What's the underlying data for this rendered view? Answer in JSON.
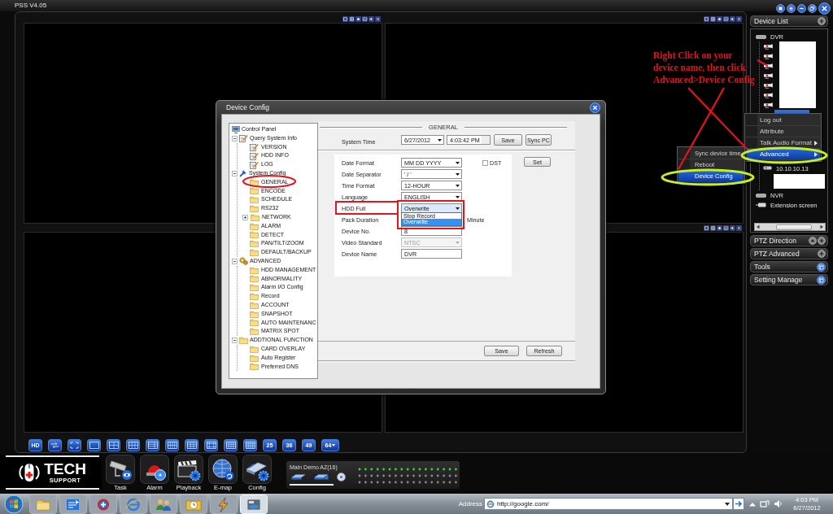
{
  "window": {
    "title": "PSS V4.05"
  },
  "video_wall": {
    "quality_button": "HD",
    "split_buttons": [
      {
        "label": "25",
        "menu": false
      },
      {
        "label": "36",
        "menu": false
      },
      {
        "label": "49",
        "menu": false
      },
      {
        "label": "64",
        "menu": true
      }
    ]
  },
  "sidebar": {
    "device_list": {
      "title": "Device List",
      "tree": [
        {
          "kind": "group",
          "label": "DVR",
          "selected": false,
          "children": [
            {
              "kind": "channel",
              "selected": false
            },
            {
              "kind": "channel",
              "selected": false
            },
            {
              "kind": "channel",
              "selected": false
            },
            {
              "kind": "channel",
              "selected": false
            },
            {
              "kind": "channel",
              "selected": false
            },
            {
              "kind": "channel",
              "selected": false
            },
            {
              "kind": "channel",
              "selected": false
            },
            {
              "kind": "device",
              "selected": true
            },
            {
              "kind": "device",
              "label": "10.10.10.13",
              "selected": false
            }
          ]
        },
        {
          "kind": "group",
          "label": "NVR",
          "selected": false
        },
        {
          "kind": "screen",
          "label": "Extension screen",
          "selected": false
        }
      ]
    },
    "sections": [
      {
        "kind": "control",
        "title": "PTZ Direction"
      },
      {
        "kind": "expand",
        "title": "PTZ Advanced"
      },
      {
        "kind": "popup",
        "title": "Tools"
      },
      {
        "kind": "popup",
        "title": "Setting Manage"
      }
    ]
  },
  "context_menu": {
    "items": [
      {
        "label": "Log out",
        "submenu": false,
        "selected": false
      },
      {
        "label": "Attribute",
        "submenu": false,
        "selected": false
      },
      {
        "label": "Talk Audio Format",
        "submenu": true,
        "selected": false
      },
      {
        "label": "Advanced",
        "submenu": true,
        "selected": true
      }
    ],
    "submenu": {
      "items": [
        {
          "label": "Sync device time",
          "selected": false
        },
        {
          "label": "Reboot",
          "selected": false
        },
        {
          "label": "Device Config",
          "selected": true
        }
      ]
    }
  },
  "annotation": {
    "text": "Right Click on your\ndevice name, then click\nAdvanced>Device Config"
  },
  "dialog": {
    "title": "Device Config",
    "tree": [
      {
        "label": "Control Panel"
      },
      {
        "label": "Query System Info",
        "expanded": true,
        "children": [
          {
            "label": "VERSION"
          },
          {
            "label": "HDD INFO"
          },
          {
            "label": "LOG"
          }
        ]
      },
      {
        "label": "System Config",
        "expanded": true,
        "children": [
          {
            "label": "GENERAL"
          },
          {
            "label": "ENCODE"
          },
          {
            "label": "SCHEDULE"
          },
          {
            "label": "RS232"
          },
          {
            "label": "NETWORK",
            "expanded": false
          },
          {
            "label": "ALARM"
          },
          {
            "label": "DETECT"
          },
          {
            "label": "PAN/TILT/ZOOM"
          },
          {
            "label": "DEFAULT/BACKUP"
          }
        ]
      },
      {
        "label": "ADVANCED",
        "expanded": true,
        "children": [
          {
            "label": "HDD MANAGEMENT"
          },
          {
            "label": "ABNORMALITY"
          },
          {
            "label": "Alarm I/O Config"
          },
          {
            "label": "Record"
          },
          {
            "label": "ACCOUNT"
          },
          {
            "label": "SNAPSHOT"
          },
          {
            "label": "AUTO MAINTENANC"
          },
          {
            "label": "MATRIX SPOT"
          }
        ]
      },
      {
        "label": "ADDTIONAL FUNCTION",
        "expanded": true,
        "children": [
          {
            "label": "CARD OVERLAY"
          },
          {
            "label": "Auto Register"
          },
          {
            "label": "Preferred DNS"
          }
        ]
      }
    ],
    "panel": {
      "title": "GENERAL",
      "system_time": {
        "label": "System Time",
        "date": "6/27/2012",
        "time": "4:03:42 PM",
        "buttons": [
          "Save",
          "Sync PC"
        ]
      },
      "fields": [
        {
          "kind": "select",
          "label": "Date Format",
          "value": "MM DD YYYY",
          "disabled": false,
          "open": false
        },
        {
          "kind": "select",
          "label": "Date Separator",
          "value": "' / '",
          "disabled": false,
          "open": false
        },
        {
          "kind": "select",
          "label": "Time Format",
          "value": "12-HOUR",
          "disabled": false,
          "open": false
        },
        {
          "kind": "select",
          "label": "Language",
          "value": "ENGLISH",
          "disabled": false,
          "open": false
        },
        {
          "kind": "select",
          "label": "HDD Full",
          "value": "Overwrite",
          "disabled": false,
          "open": true,
          "options": [
            {
              "label": "Stop Record",
              "selected": false
            },
            {
              "label": "Overwrite",
              "selected": true
            }
          ]
        },
        {
          "kind": "number",
          "label": "Pack Duration",
          "unit": "Minute"
        },
        {
          "kind": "number",
          "label": "Device No.",
          "value": "8"
        },
        {
          "kind": "select",
          "label": "Video Standard",
          "value": "NTSC",
          "disabled": true,
          "open": false
        },
        {
          "kind": "text",
          "label": "Device Name",
          "value": "DVR"
        }
      ],
      "dst": {
        "label": "DST",
        "checked": false
      },
      "set_button": "Set",
      "buttons": [
        "Save",
        "Refresh"
      ]
    }
  },
  "toolbar": {
    "logo": {
      "title": "TECH",
      "subtitle": "SUPPORT"
    },
    "modules": [
      {
        "label": "Task"
      },
      {
        "label": "Alarm"
      },
      {
        "label": "Playback"
      },
      {
        "label": "E-map"
      },
      {
        "label": "Config"
      }
    ],
    "device_status": {
      "title": "Main Demo AZ(16)"
    }
  },
  "taskbar": {
    "pinned_apps": [
      {
        "active": false
      },
      {
        "active": false
      },
      {
        "active": false
      },
      {
        "active": false
      },
      {
        "active": false
      },
      {
        "active": false
      },
      {
        "active": false
      },
      {
        "active": true
      }
    ],
    "address": {
      "label": "Address",
      "value": "http://google.com/"
    },
    "clock": {
      "time": "4:03 PM",
      "date": "6/27/2012"
    }
  }
}
